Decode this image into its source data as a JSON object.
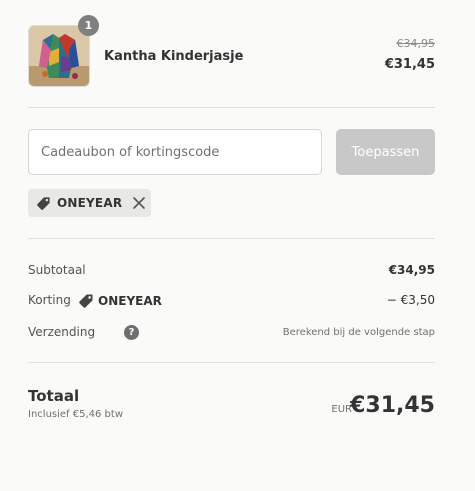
{
  "line_item": {
    "quantity": "1",
    "name": "Kantha Kinderjasje",
    "original_price": "€34,95",
    "price": "€31,45",
    "image_icon": "jacket-thumbnail"
  },
  "discount_form": {
    "placeholder": "Cadeaubon of kortingscode",
    "value": "",
    "apply_label": "Toepassen"
  },
  "applied_code": {
    "code": "ONEYEAR",
    "icon": "tag-icon",
    "remove_icon": "close-icon"
  },
  "summary": {
    "subtotal_label": "Subtotaal",
    "subtotal_value": "€34,95",
    "discount_label": "Korting",
    "discount_code": "ONEYEAR",
    "discount_value": "− €3,50",
    "shipping_label": "Verzending",
    "shipping_help_icon": "question-icon",
    "shipping_value": "Berekend bij de volgende stap"
  },
  "total": {
    "label": "Totaal",
    "tax_note": "Inclusief €5,46 btw",
    "currency": "EUR",
    "value": "€31,45"
  },
  "colors": {
    "background": "#fafaf8",
    "text": "#333333",
    "muted": "#707070",
    "disabled_button": "#c8c8c8",
    "chip_background": "#e8e8e4",
    "badge": "#7f7f7f"
  }
}
